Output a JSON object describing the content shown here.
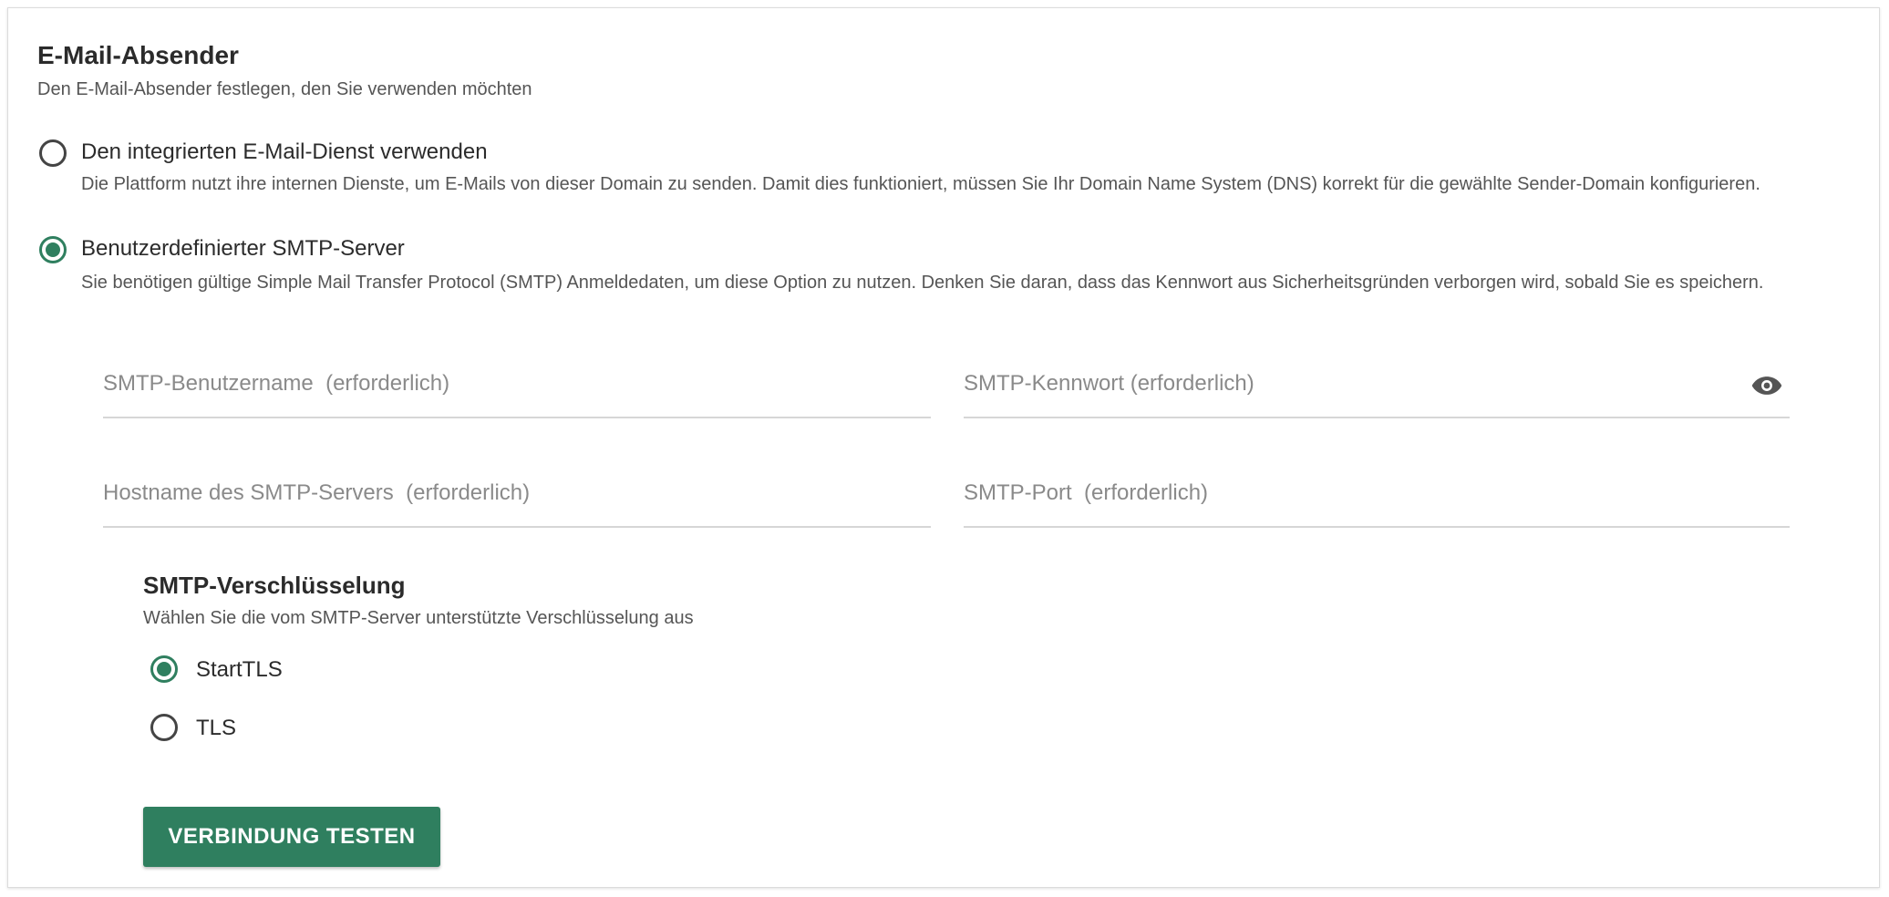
{
  "section": {
    "title": "E-Mail-Absender",
    "subtitle": "Den E-Mail-Absender festlegen, den Sie verwenden möchten"
  },
  "sender_options": [
    {
      "label": "Den integrierten E-Mail-Dienst verwenden",
      "description": "Die Plattform nutzt ihre internen Dienste, um E-Mails von dieser Domain zu senden. Damit dies funktioniert, müssen Sie Ihr Domain Name System (DNS) korrekt für die gewählte Sender-Domain konfigurieren.",
      "selected": false
    },
    {
      "label": "Benutzerdefinierter SMTP-Server",
      "description": "Sie benötigen gültige Simple Mail Transfer Protocol (SMTP) Anmeldedaten, um diese Option zu nutzen. Denken Sie daran, dass das Kennwort aus Sicherheitsgründen verborgen wird, sobald Sie es speichern.",
      "selected": true
    }
  ],
  "fields": {
    "username": {
      "value": "",
      "placeholder": "SMTP-Benutzername  (erforderlich)"
    },
    "password": {
      "value": "",
      "placeholder": "SMTP-Kennwort (erforderlich)"
    },
    "hostname": {
      "value": "",
      "placeholder": "Hostname des SMTP-Servers  (erforderlich)"
    },
    "port": {
      "value": "",
      "placeholder": "SMTP-Port  (erforderlich)"
    }
  },
  "encryption": {
    "title": "SMTP-Verschlüsselung",
    "subtitle": "Wählen Sie die vom SMTP-Server unterstützte Verschlüsselung aus",
    "options": [
      {
        "label": "StartTLS",
        "selected": true
      },
      {
        "label": "TLS",
        "selected": false
      }
    ]
  },
  "test_button": {
    "label": "VERBINDUNG TESTEN"
  },
  "icons": {
    "password_toggle": "eye-icon"
  },
  "colors": {
    "accent": "#2f7f5f",
    "border": "#d6d6d6",
    "muted_text": "#555555"
  }
}
